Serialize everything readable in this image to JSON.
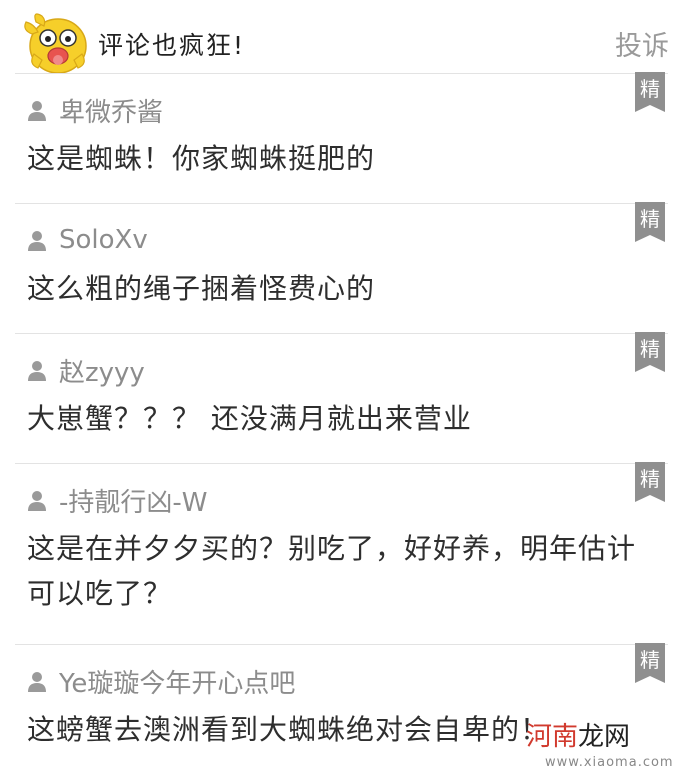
{
  "header": {
    "title": "评论也疯狂!",
    "report_label": "投诉"
  },
  "badge_label": "精",
  "comments": [
    {
      "username": "卑微乔酱",
      "text": "这是蜘蛛！你家蜘蛛挺肥的"
    },
    {
      "username": "SoloXv",
      "text": "这么粗的绳子捆着怪费心的"
    },
    {
      "username": "赵zyyy",
      "text": "大崽蟹？？？ 还没满月就出来营业"
    },
    {
      "username": "-持靓行凶-W",
      "text": "这是在并夕夕买的？别吃了，好好养，明年估计可以吃了？"
    },
    {
      "username": "Ye璇璇今年开心点吧",
      "text": "这螃蟹去澳洲看到大蜘蛛绝对会自卑的！"
    }
  ],
  "watermark": {
    "brand_red": "河南",
    "brand_dark": "龙网",
    "url": "www.xiaoma.com"
  },
  "colors": {
    "divider": "#e3e3e3",
    "username": "#8c8c8c",
    "badge": "#8f8f8f",
    "mascot": "#f6cf2a"
  }
}
